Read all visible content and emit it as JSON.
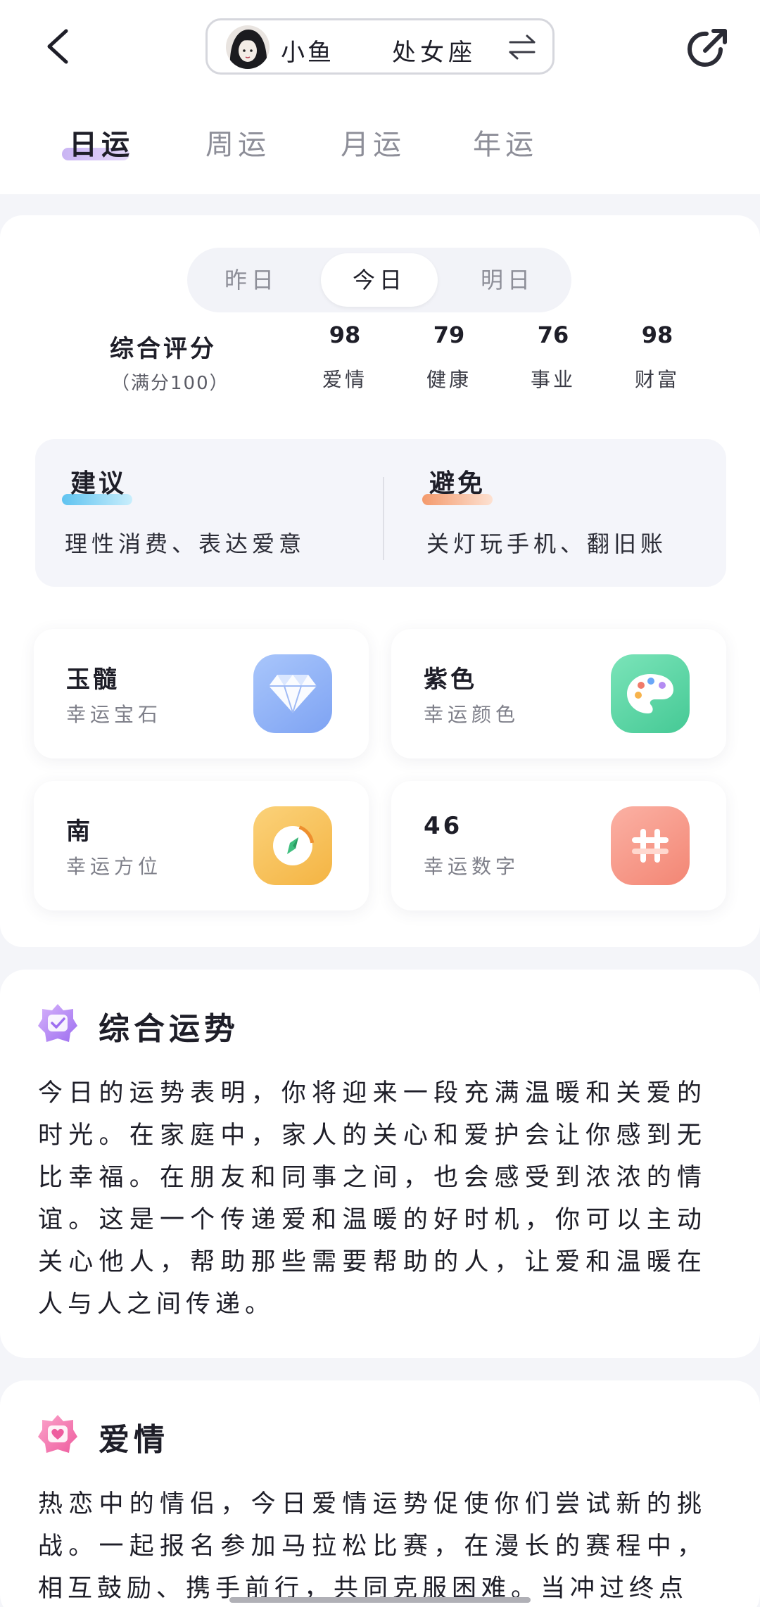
{
  "header": {
    "profile_name": "小鱼",
    "zodiac_sign": "处女座",
    "tabs": [
      "日运",
      "周运",
      "月运",
      "年运"
    ],
    "active_tab": 0
  },
  "day_switch": {
    "options": [
      "昨日",
      "今日",
      "明日"
    ],
    "active": 1
  },
  "scores": {
    "title": "综合评分",
    "subtitle": "（满分100）",
    "items": [
      {
        "value": "98",
        "label": "爱情"
      },
      {
        "value": "79",
        "label": "健康"
      },
      {
        "value": "76",
        "label": "事业"
      },
      {
        "value": "98",
        "label": "财富"
      }
    ]
  },
  "advice": {
    "do_title": "建议",
    "do_text": "理性消费、表达爱意",
    "avoid_title": "避免",
    "avoid_text": "关灯玩手机、翻旧账"
  },
  "lucky": [
    {
      "value": "玉髓",
      "label": "幸运宝石",
      "icon": "diamond-icon",
      "color": "#8fb3f7"
    },
    {
      "value": "紫色",
      "label": "幸运颜色",
      "icon": "palette-icon",
      "color": "#5fd7a8"
    },
    {
      "value": "南",
      "label": "幸运方位",
      "icon": "compass-icon",
      "color": "#f7c15c"
    },
    {
      "value": "46",
      "label": "幸运数字",
      "icon": "hash-icon",
      "color": "#f79a8c"
    }
  ],
  "overall": {
    "title": "综合运势",
    "text": "今日的运势表明，你将迎来一段充满温暖和关爱的时光。在家庭中，家人的关心和爱护会让你感到无比幸福。在朋友和同事之间，也会感受到浓浓的情谊。这是一个传递爱和温暖的好时机，你可以主动关心他人，帮助那些需要帮助的人，让爱和温暖在人与人之间传递。"
  },
  "love": {
    "title": "爱情",
    "text": "热恋中的情侣，今日爱情运势促使你们尝试新的挑战。一起报名参加马拉松比赛，在漫长的赛程中，相互鼓励、携手前行，共同克服困难。当冲过终点"
  },
  "colors": {
    "accent_purple": "#c9b4f3",
    "advice_blue": "#5fc3f0",
    "avoid_orange": "#f49a6c"
  }
}
